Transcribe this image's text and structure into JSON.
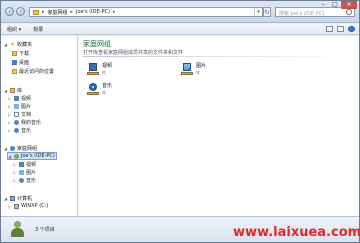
{
  "address": {
    "crumbs": [
      "家庭网组",
      "Joe's (IDE-PC)"
    ],
    "search_placeholder": "搜索 Joe's (IDE-PC)"
  },
  "toolbar": {
    "organize": "组织 ▾",
    "share": "刻录"
  },
  "sidebar": {
    "favorites": {
      "header": "收藏夹",
      "items": [
        "下载",
        "桌面",
        "最近访问的位置"
      ]
    },
    "libraries": {
      "header": "库",
      "items": [
        "视频",
        "图片",
        "文档",
        "我的音乐",
        "音乐"
      ]
    },
    "homegroup": {
      "header": "家庭网组",
      "user": "Joe's (IDE-PC)",
      "items": [
        "视频",
        "图片",
        "音乐"
      ]
    },
    "computer": {
      "header": "计算机",
      "items": [
        "WINXP (C:)"
      ]
    }
  },
  "main": {
    "title": "家庭网组",
    "subtitle": "打开库查看家庭网组成员共享的文件夹和文件",
    "items": [
      {
        "name": "视频",
        "state": "库"
      },
      {
        "name": "图片",
        "state": "库"
      },
      {
        "name": "音乐",
        "state": "库"
      }
    ]
  },
  "status": {
    "count": "3 个项目"
  },
  "watermark": "www.laixuea.com"
}
